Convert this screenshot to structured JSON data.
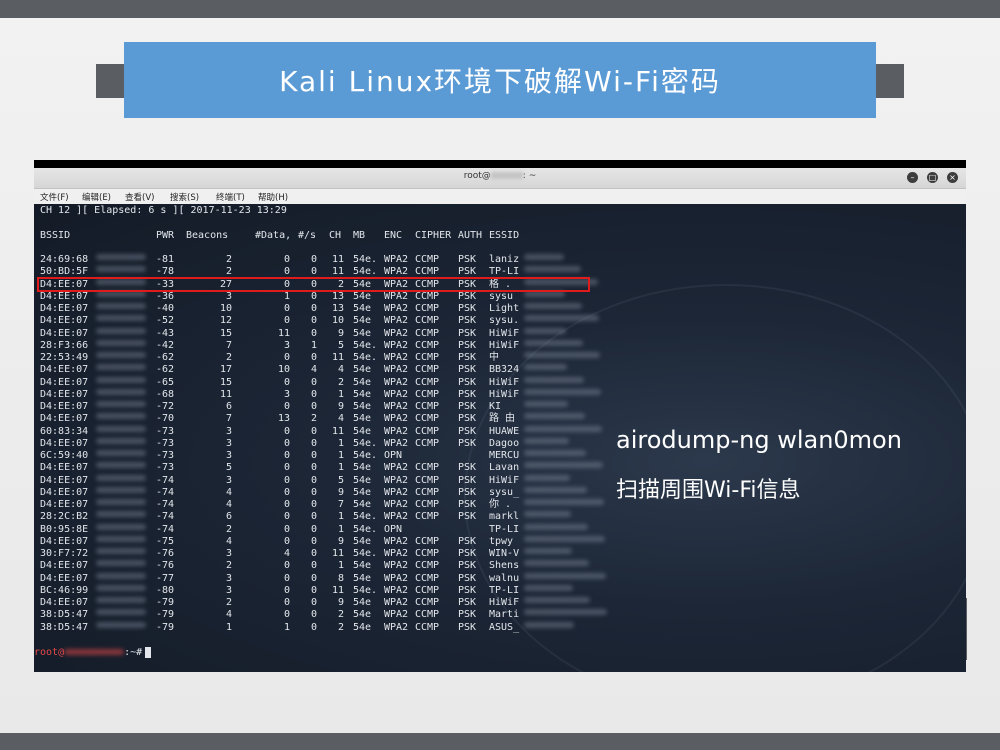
{
  "slide": {
    "title": "Kali Linux环境下破解Wi-Fi密码"
  },
  "window": {
    "title_prefix": "root@",
    "title_suffix": ": ~",
    "menu": [
      "文件(F)",
      "编辑(E)",
      "查看(V)",
      "搜索(S)",
      "终端(T)",
      "帮助(H)"
    ]
  },
  "terminal": {
    "status_line": "CH 12 ][ Elapsed: 6 s ][ 2017-11-23 13:29",
    "headers": [
      "BSSID",
      "PWR",
      "Beacons",
      "#Data,",
      "#/s",
      "CH",
      "MB",
      "ENC",
      "CIPHER",
      "AUTH",
      "ESSID"
    ],
    "rows": [
      {
        "bssid": "24:69:68",
        "pwr": "-81",
        "beacons": "2",
        "data": "0",
        "ps": "0",
        "ch": "11",
        "mb": "54e.",
        "enc": "WPA2",
        "cipher": "CCMP",
        "auth": "PSK",
        "essid": "laniz"
      },
      {
        "bssid": "50:BD:5F",
        "pwr": "-78",
        "beacons": "2",
        "data": "0",
        "ps": "0",
        "ch": "11",
        "mb": "54e.",
        "enc": "WPA2",
        "cipher": "CCMP",
        "auth": "PSK",
        "essid": "TP-LI"
      },
      {
        "bssid": "D4:EE:07",
        "pwr": "-33",
        "beacons": "27",
        "data": "0",
        "ps": "0",
        "ch": "2",
        "mb": "54e",
        "enc": "WPA2",
        "cipher": "CCMP",
        "auth": "PSK",
        "essid": "格 ."
      },
      {
        "bssid": "D4:EE:07",
        "pwr": "-36",
        "beacons": "3",
        "data": "1",
        "ps": "0",
        "ch": "13",
        "mb": "54e",
        "enc": "WPA2",
        "cipher": "CCMP",
        "auth": "PSK",
        "essid": "sysu"
      },
      {
        "bssid": "D4:EE:07",
        "pwr": "-40",
        "beacons": "10",
        "data": "0",
        "ps": "0",
        "ch": "13",
        "mb": "54e",
        "enc": "WPA2",
        "cipher": "CCMP",
        "auth": "PSK",
        "essid": "Light"
      },
      {
        "bssid": "D4:EE:07",
        "pwr": "-52",
        "beacons": "12",
        "data": "0",
        "ps": "0",
        "ch": "10",
        "mb": "54e",
        "enc": "WPA2",
        "cipher": "CCMP",
        "auth": "PSK",
        "essid": "sysu."
      },
      {
        "bssid": "D4:EE:07",
        "pwr": "-43",
        "beacons": "15",
        "data": "11",
        "ps": "0",
        "ch": "9",
        "mb": "54e",
        "enc": "WPA2",
        "cipher": "CCMP",
        "auth": "PSK",
        "essid": "HiWiF"
      },
      {
        "bssid": "28:F3:66",
        "pwr": "-42",
        "beacons": "7",
        "data": "3",
        "ps": "1",
        "ch": "5",
        "mb": "54e.",
        "enc": "WPA2",
        "cipher": "CCMP",
        "auth": "PSK",
        "essid": "HiWiF"
      },
      {
        "bssid": "22:53:49",
        "pwr": "-62",
        "beacons": "2",
        "data": "0",
        "ps": "0",
        "ch": "11",
        "mb": "54e.",
        "enc": "WPA2",
        "cipher": "CCMP",
        "auth": "PSK",
        "essid": "中"
      },
      {
        "bssid": "D4:EE:07",
        "pwr": "-62",
        "beacons": "17",
        "data": "10",
        "ps": "4",
        "ch": "4",
        "mb": "54e",
        "enc": "WPA2",
        "cipher": "CCMP",
        "auth": "PSK",
        "essid": "BB324"
      },
      {
        "bssid": "D4:EE:07",
        "pwr": "-65",
        "beacons": "15",
        "data": "0",
        "ps": "0",
        "ch": "2",
        "mb": "54e",
        "enc": "WPA2",
        "cipher": "CCMP",
        "auth": "PSK",
        "essid": "HiWiF"
      },
      {
        "bssid": "D4:EE:07",
        "pwr": "-68",
        "beacons": "11",
        "data": "3",
        "ps": "0",
        "ch": "1",
        "mb": "54e",
        "enc": "WPA2",
        "cipher": "CCMP",
        "auth": "PSK",
        "essid": "HiWiF"
      },
      {
        "bssid": "D4:EE:07",
        "pwr": "-72",
        "beacons": "6",
        "data": "0",
        "ps": "0",
        "ch": "9",
        "mb": "54e",
        "enc": "WPA2",
        "cipher": "CCMP",
        "auth": "PSK",
        "essid": "KI"
      },
      {
        "bssid": "D4:EE:07",
        "pwr": "-70",
        "beacons": "7",
        "data": "13",
        "ps": "2",
        "ch": "4",
        "mb": "54e",
        "enc": "WPA2",
        "cipher": "CCMP",
        "auth": "PSK",
        "essid": "路 由"
      },
      {
        "bssid": "60:83:34",
        "pwr": "-73",
        "beacons": "3",
        "data": "0",
        "ps": "0",
        "ch": "11",
        "mb": "54e",
        "enc": "WPA2",
        "cipher": "CCMP",
        "auth": "PSK",
        "essid": "HUAWE"
      },
      {
        "bssid": "D4:EE:07",
        "pwr": "-73",
        "beacons": "3",
        "data": "0",
        "ps": "0",
        "ch": "1",
        "mb": "54e.",
        "enc": "WPA2",
        "cipher": "CCMP",
        "auth": "PSK",
        "essid": "Dagoo"
      },
      {
        "bssid": "6C:59:40",
        "pwr": "-73",
        "beacons": "3",
        "data": "0",
        "ps": "0",
        "ch": "1",
        "mb": "54e.",
        "enc": "OPN",
        "cipher": "",
        "auth": "",
        "essid": "MERCU"
      },
      {
        "bssid": "D4:EE:07",
        "pwr": "-73",
        "beacons": "5",
        "data": "0",
        "ps": "0",
        "ch": "1",
        "mb": "54e",
        "enc": "WPA2",
        "cipher": "CCMP",
        "auth": "PSK",
        "essid": "Lavan"
      },
      {
        "bssid": "D4:EE:07",
        "pwr": "-74",
        "beacons": "3",
        "data": "0",
        "ps": "0",
        "ch": "5",
        "mb": "54e",
        "enc": "WPA2",
        "cipher": "CCMP",
        "auth": "PSK",
        "essid": "HiWiF"
      },
      {
        "bssid": "D4:EE:07",
        "pwr": "-74",
        "beacons": "4",
        "data": "0",
        "ps": "0",
        "ch": "9",
        "mb": "54e",
        "enc": "WPA2",
        "cipher": "CCMP",
        "auth": "PSK",
        "essid": "sysu_"
      },
      {
        "bssid": "D4:EE:07",
        "pwr": "-74",
        "beacons": "4",
        "data": "0",
        "ps": "0",
        "ch": "7",
        "mb": "54e",
        "enc": "WPA2",
        "cipher": "CCMP",
        "auth": "PSK",
        "essid": "你 ."
      },
      {
        "bssid": "28:2C:B2",
        "pwr": "-74",
        "beacons": "6",
        "data": "0",
        "ps": "0",
        "ch": "1",
        "mb": "54e.",
        "enc": "WPA2",
        "cipher": "CCMP",
        "auth": "PSK",
        "essid": "markl"
      },
      {
        "bssid": "B0:95:8E",
        "pwr": "-74",
        "beacons": "2",
        "data": "0",
        "ps": "0",
        "ch": "1",
        "mb": "54e.",
        "enc": "OPN",
        "cipher": "",
        "auth": "",
        "essid": "TP-LI"
      },
      {
        "bssid": "D4:EE:07",
        "pwr": "-75",
        "beacons": "4",
        "data": "0",
        "ps": "0",
        "ch": "9",
        "mb": "54e",
        "enc": "WPA2",
        "cipher": "CCMP",
        "auth": "PSK",
        "essid": "tpwy"
      },
      {
        "bssid": "30:F7:72",
        "pwr": "-76",
        "beacons": "3",
        "data": "4",
        "ps": "0",
        "ch": "11",
        "mb": "54e.",
        "enc": "WPA2",
        "cipher": "CCMP",
        "auth": "PSK",
        "essid": "WIN-V"
      },
      {
        "bssid": "D4:EE:07",
        "pwr": "-76",
        "beacons": "2",
        "data": "0",
        "ps": "0",
        "ch": "1",
        "mb": "54e",
        "enc": "WPA2",
        "cipher": "CCMP",
        "auth": "PSK",
        "essid": "Shens"
      },
      {
        "bssid": "D4:EE:07",
        "pwr": "-77",
        "beacons": "3",
        "data": "0",
        "ps": "0",
        "ch": "8",
        "mb": "54e",
        "enc": "WPA2",
        "cipher": "CCMP",
        "auth": "PSK",
        "essid": "walnu"
      },
      {
        "bssid": "BC:46:99",
        "pwr": "-80",
        "beacons": "3",
        "data": "0",
        "ps": "0",
        "ch": "11",
        "mb": "54e.",
        "enc": "WPA2",
        "cipher": "CCMP",
        "auth": "PSK",
        "essid": "TP-LI"
      },
      {
        "bssid": "D4:EE:07",
        "pwr": "-79",
        "beacons": "2",
        "data": "0",
        "ps": "0",
        "ch": "9",
        "mb": "54e",
        "enc": "WPA2",
        "cipher": "CCMP",
        "auth": "PSK",
        "essid": "HiWiF"
      },
      {
        "bssid": "38:D5:47",
        "pwr": "-79",
        "beacons": "4",
        "data": "0",
        "ps": "0",
        "ch": "2",
        "mb": "54e",
        "enc": "WPA2",
        "cipher": "CCMP",
        "auth": "PSK",
        "essid": "Marti"
      },
      {
        "bssid": "38:D5:47",
        "pwr": "-79",
        "beacons": "1",
        "data": "1",
        "ps": "0",
        "ch": "2",
        "mb": "54e",
        "enc": "WPA2",
        "cipher": "CCMP",
        "auth": "PSK",
        "essid": "ASUS_"
      }
    ],
    "prompt_user": "root@",
    "prompt_suffix": ":~#",
    "highlight_color": "#e01b1b"
  },
  "annotations": {
    "command": "airodump-ng wlan0mon",
    "description": "扫描周围Wi-Fi信息"
  }
}
